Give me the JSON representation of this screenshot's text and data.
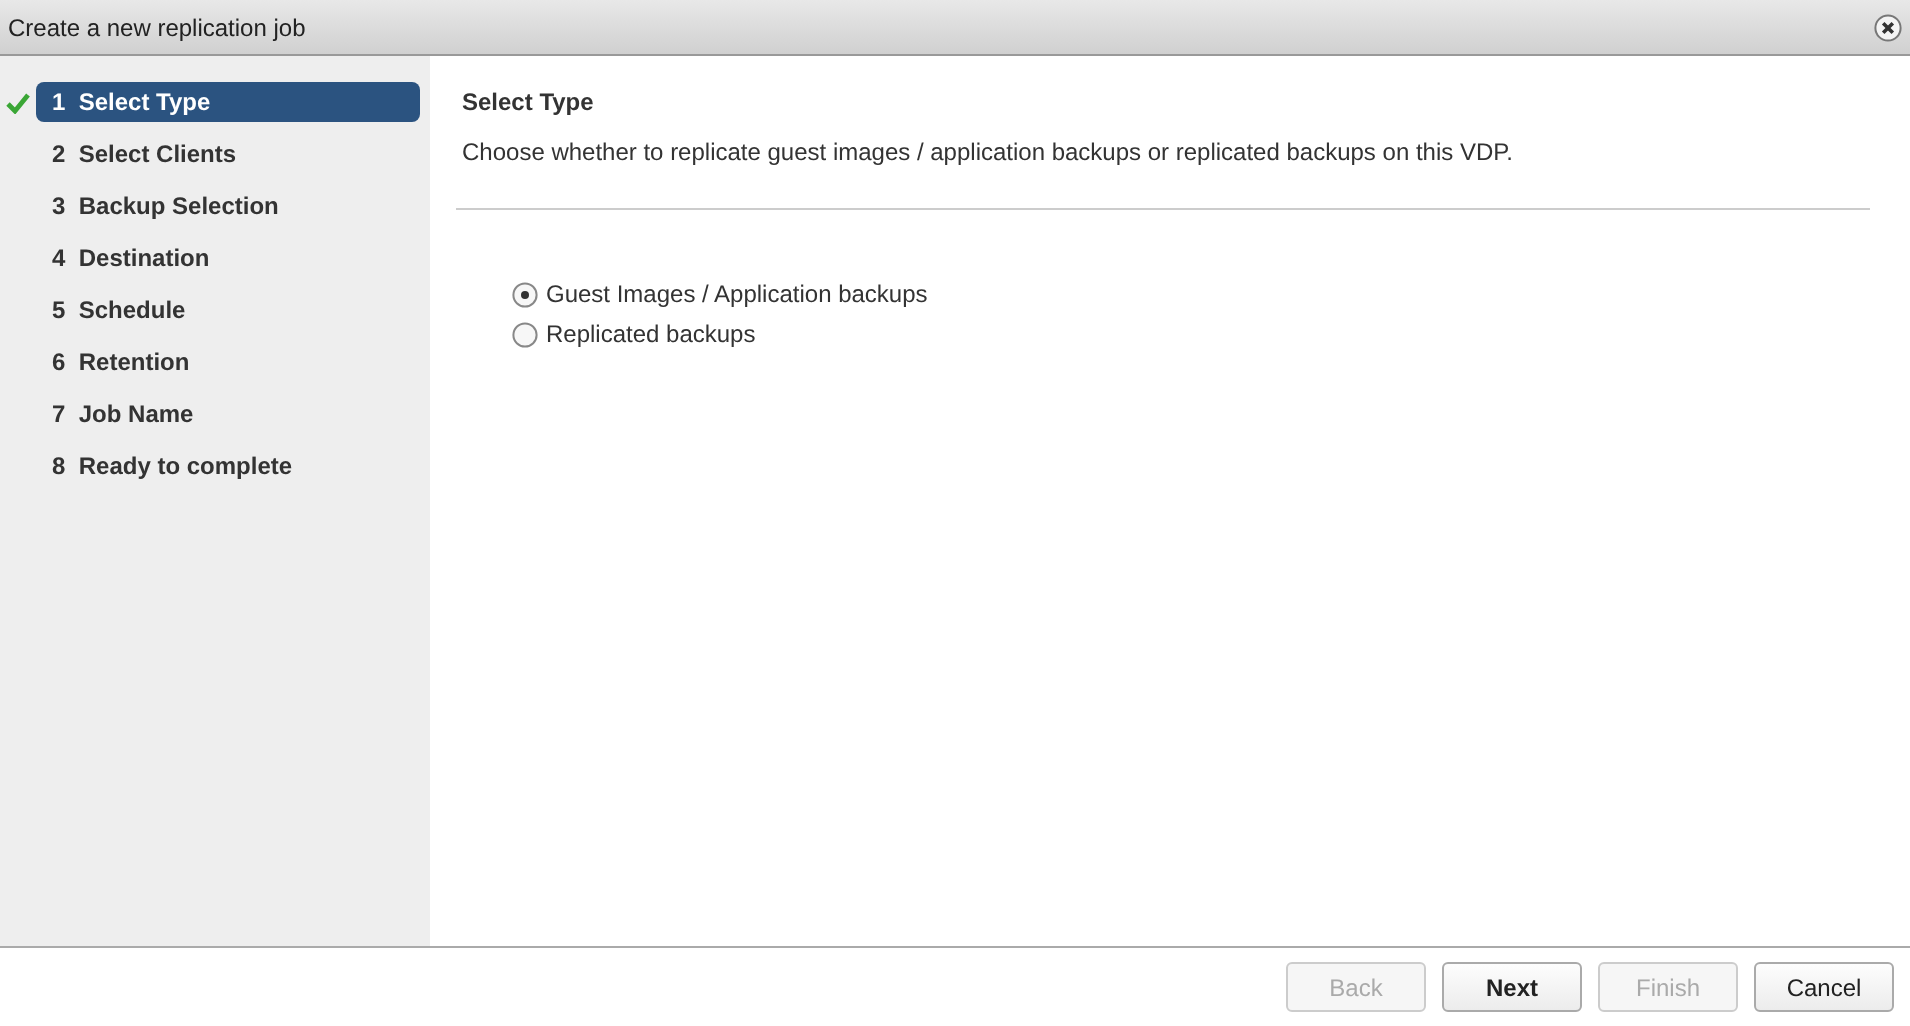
{
  "window": {
    "title": "Create a new replication job"
  },
  "steps": [
    {
      "number": "1",
      "label": "Select Type",
      "selected": true,
      "completed": true
    },
    {
      "number": "2",
      "label": "Select Clients",
      "selected": false,
      "completed": false
    },
    {
      "number": "3",
      "label": "Backup Selection",
      "selected": false,
      "completed": false
    },
    {
      "number": "4",
      "label": "Destination",
      "selected": false,
      "completed": false
    },
    {
      "number": "5",
      "label": "Schedule",
      "selected": false,
      "completed": false
    },
    {
      "number": "6",
      "label": "Retention",
      "selected": false,
      "completed": false
    },
    {
      "number": "7",
      "label": "Job Name",
      "selected": false,
      "completed": false
    },
    {
      "number": "8",
      "label": "Ready to complete",
      "selected": false,
      "completed": false
    }
  ],
  "page": {
    "heading": "Select Type",
    "description": "Choose whether to replicate guest images / application backups or replicated backups on this VDP.",
    "options": [
      {
        "label": "Guest Images / Application backups",
        "selected": true
      },
      {
        "label": "Replicated backups",
        "selected": false
      }
    ]
  },
  "buttons": [
    {
      "label": "Back",
      "disabled": true,
      "primary": false
    },
    {
      "label": "Next",
      "disabled": false,
      "primary": true
    },
    {
      "label": "Finish",
      "disabled": true,
      "primary": false
    },
    {
      "label": "Cancel",
      "disabled": false,
      "primary": false
    }
  ]
}
